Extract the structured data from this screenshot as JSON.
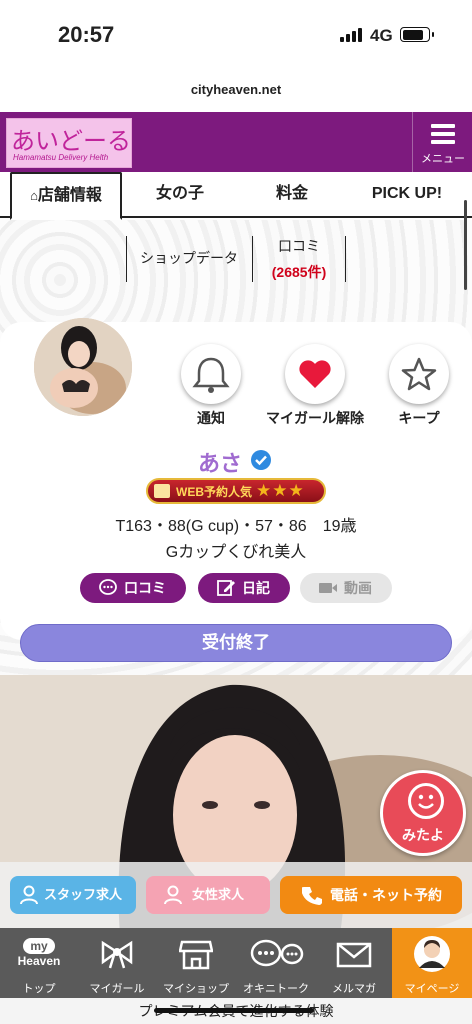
{
  "status": {
    "time": "20:57",
    "network": "4G"
  },
  "url": "cityheaven.net",
  "header": {
    "logo_text": "あいどーる",
    "logo_sub": "Hamamatsu Delivery Helth",
    "menu_label": "メニュー",
    "brand_color": "#7d1a7e"
  },
  "tabs": [
    {
      "label": "店舗情報",
      "active": true,
      "icon": "home-icon"
    },
    {
      "label": "女の子"
    },
    {
      "label": "料金"
    },
    {
      "label": "PICK UP!"
    }
  ],
  "subnav": {
    "shop_data": "ショップデータ",
    "reviews_label": "口コミ",
    "reviews_count": "(2685件)"
  },
  "profile": {
    "actions": [
      {
        "label": "通知",
        "icon": "bell-icon"
      },
      {
        "label": "マイガール解除",
        "icon": "heart-icon"
      },
      {
        "label": "キープ",
        "icon": "star-icon"
      }
    ],
    "name": "あさ",
    "badge_text": "WEB予約人気",
    "badge_stars": "★★★",
    "stats": "T163・88(G cup)・57・86　19歳",
    "catchphrase": "Gカップくびれ美人",
    "buttons": [
      {
        "label": "口コミ",
        "icon": "chat-icon",
        "enabled": true
      },
      {
        "label": "日記",
        "icon": "edit-icon",
        "enabled": true
      },
      {
        "label": "動画",
        "icon": "video-icon",
        "enabled": false
      }
    ],
    "reception": "受付終了"
  },
  "mitayo_label": "みたよ",
  "cta": {
    "staff": "スタッフ求人",
    "female": "女性求人",
    "reserve": "電話・ネット予約"
  },
  "bottom_nav": [
    {
      "label": "トップ",
      "icon": "my-heaven-logo",
      "logo_top": "my",
      "logo_bottom": "Heaven"
    },
    {
      "label": "マイガール",
      "icon": "ribbon-icon"
    },
    {
      "label": "マイショップ",
      "icon": "shop-icon"
    },
    {
      "label": "オキニトーク",
      "icon": "chat-bubbles-icon"
    },
    {
      "label": "メルマガ",
      "icon": "mail-icon"
    },
    {
      "label": "マイページ",
      "icon": "user-avatar-icon",
      "active": true
    }
  ],
  "promo": "プレミアム会員で進化する体験"
}
